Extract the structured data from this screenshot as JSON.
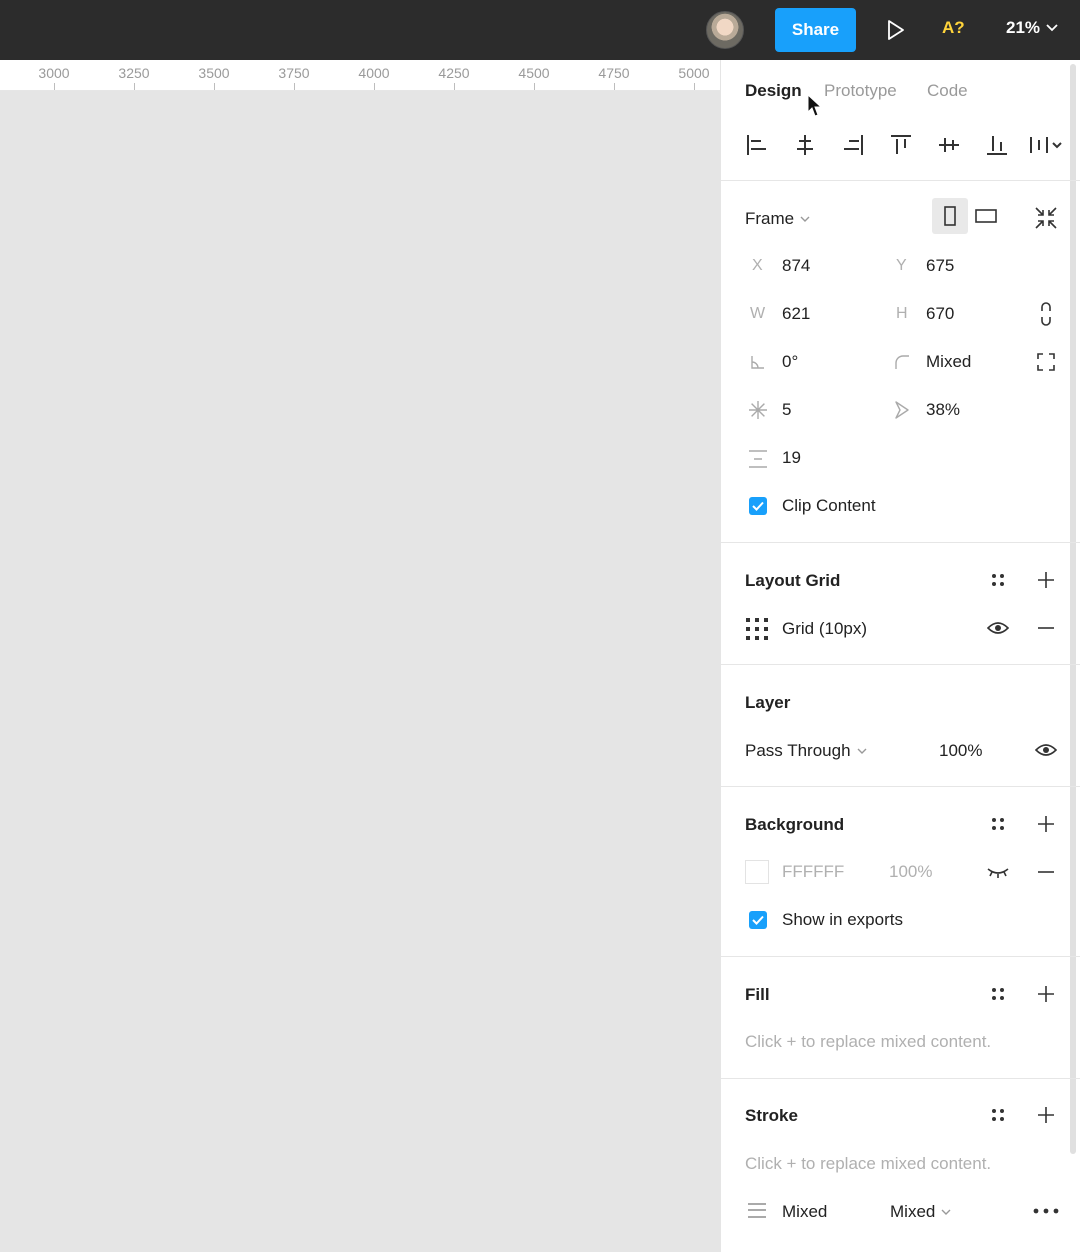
{
  "topbar": {
    "share_label": "Share",
    "a11y_label": "A?",
    "zoom_label": "21%"
  },
  "ruler": {
    "ticks": [
      "3000",
      "3250",
      "3500",
      "3750",
      "4000",
      "4250",
      "4500",
      "4750",
      "5000"
    ]
  },
  "panel": {
    "tabs": {
      "design": "Design",
      "prototype": "Prototype",
      "code": "Code"
    },
    "frame": {
      "label": "Frame",
      "x_label": "X",
      "x_value": "874",
      "y_label": "Y",
      "y_value": "675",
      "w_label": "W",
      "w_value": "621",
      "h_label": "H",
      "h_value": "670",
      "rotation": "0°",
      "radius": "Mixed",
      "points": "5",
      "ratio": "38%",
      "spacing": "19",
      "clip_content_label": "Clip Content"
    },
    "layout_grid": {
      "title": "Layout Grid",
      "grid_label": "Grid (10px)"
    },
    "layer": {
      "title": "Layer",
      "blend_mode": "Pass Through",
      "opacity": "100%"
    },
    "background": {
      "title": "Background",
      "hex": "FFFFFF",
      "opacity": "100%",
      "show_exports_label": "Show in exports"
    },
    "fill": {
      "title": "Fill",
      "hint": "Click + to replace mixed content."
    },
    "stroke": {
      "title": "Stroke",
      "hint": "Click + to replace mixed content.",
      "weight": "Mixed",
      "position": "Mixed"
    }
  },
  "colors": {
    "accent": "#18a0fb",
    "topbar": "#2c2c2c",
    "a11y": "#ffd43b",
    "canvas": "#e5e5e5"
  }
}
